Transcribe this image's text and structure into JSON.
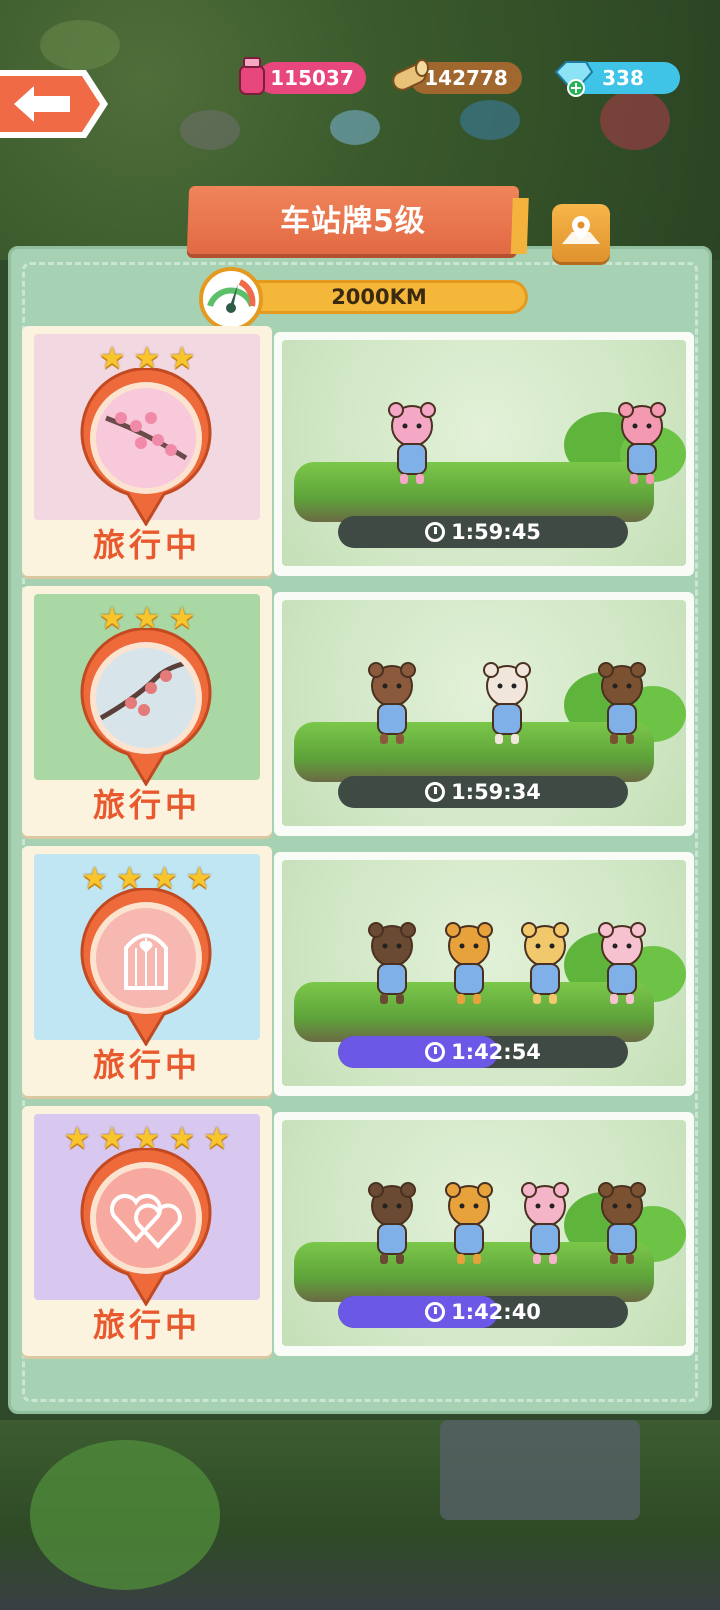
{
  "header": {
    "resources": [
      {
        "name": "ink",
        "value": "115037",
        "color": "#e8477d",
        "icon": "potion-icon"
      },
      {
        "name": "wood",
        "value": "142778",
        "color": "#b07a3c",
        "icon": "log-icon"
      },
      {
        "name": "gems",
        "value": "338",
        "color": "#3fc4e8",
        "icon": "gem-icon"
      }
    ],
    "back_icon": "back-arrow-icon"
  },
  "panel": {
    "title": "车站牌5级",
    "map_icon": "map-pin-icon",
    "distance": "2000KM"
  },
  "cards": [
    {
      "stars": 3,
      "status": "旅行中",
      "timer": "1:59:45",
      "progress": 0.0,
      "theme": "cherry-blossom-icon",
      "bg": "#f2d8e0"
    },
    {
      "stars": 3,
      "status": "旅行中",
      "timer": "1:59:34",
      "progress": 0.0,
      "theme": "plum-branch-icon",
      "bg": "#a9d8a4"
    },
    {
      "stars": 4,
      "status": "旅行中",
      "timer": "1:42:54",
      "progress": 0.55,
      "theme": "birdcage-heart-icon",
      "bg": "#bfe6f2"
    },
    {
      "stars": 5,
      "status": "旅行中",
      "timer": "1:42:40",
      "progress": 0.55,
      "theme": "double-heart-icon",
      "bg": "#d8c7ef"
    }
  ]
}
